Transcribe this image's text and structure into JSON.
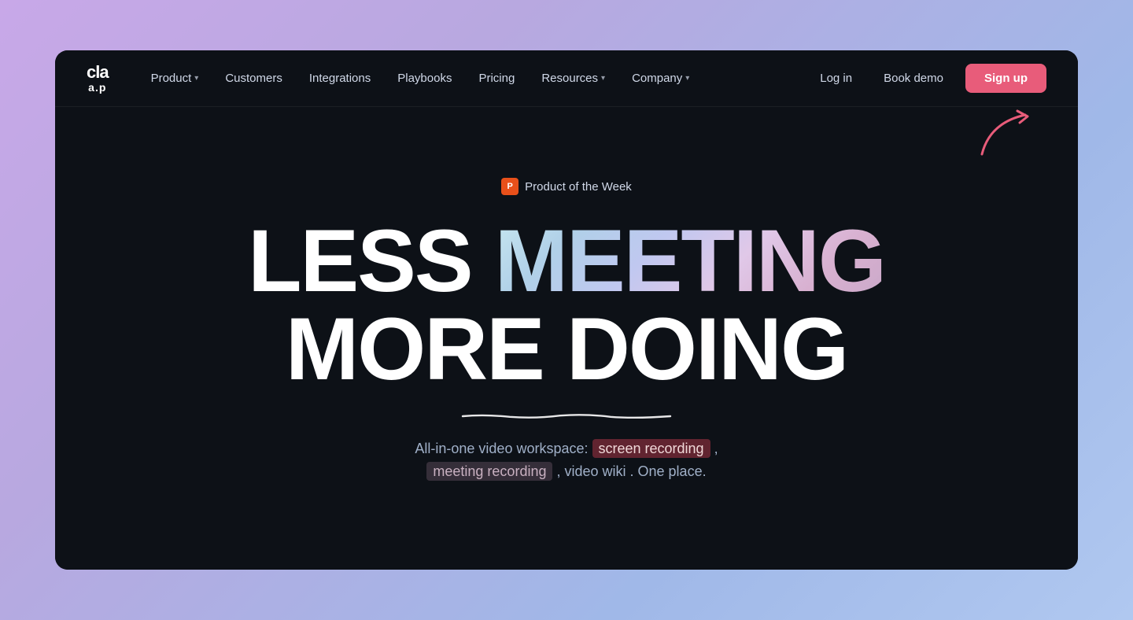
{
  "logo": {
    "line1": "cla",
    "line2": "ap"
  },
  "nav": {
    "items": [
      {
        "label": "Product",
        "hasDropdown": true
      },
      {
        "label": "Customers",
        "hasDropdown": false
      },
      {
        "label": "Integrations",
        "hasDropdown": false
      },
      {
        "label": "Playbooks",
        "hasDropdown": false
      },
      {
        "label": "Pricing",
        "hasDropdown": false
      },
      {
        "label": "Resources",
        "hasDropdown": true
      },
      {
        "label": "Company",
        "hasDropdown": true
      }
    ],
    "login_label": "Log in",
    "demo_label": "Book demo",
    "signup_label": "Sign up"
  },
  "hero": {
    "badge_icon": "P",
    "badge_text": "Product of the Week",
    "headline_less": "LESS ",
    "headline_meeting": "MEETING",
    "headline_row2": "MORE DOING",
    "description_prefix": "All-in-one video workspace: ",
    "highlight1": "screen recording",
    "description_mid": " ,",
    "highlight2": "meeting recording",
    "description_end": " ,  video wiki . One place."
  }
}
